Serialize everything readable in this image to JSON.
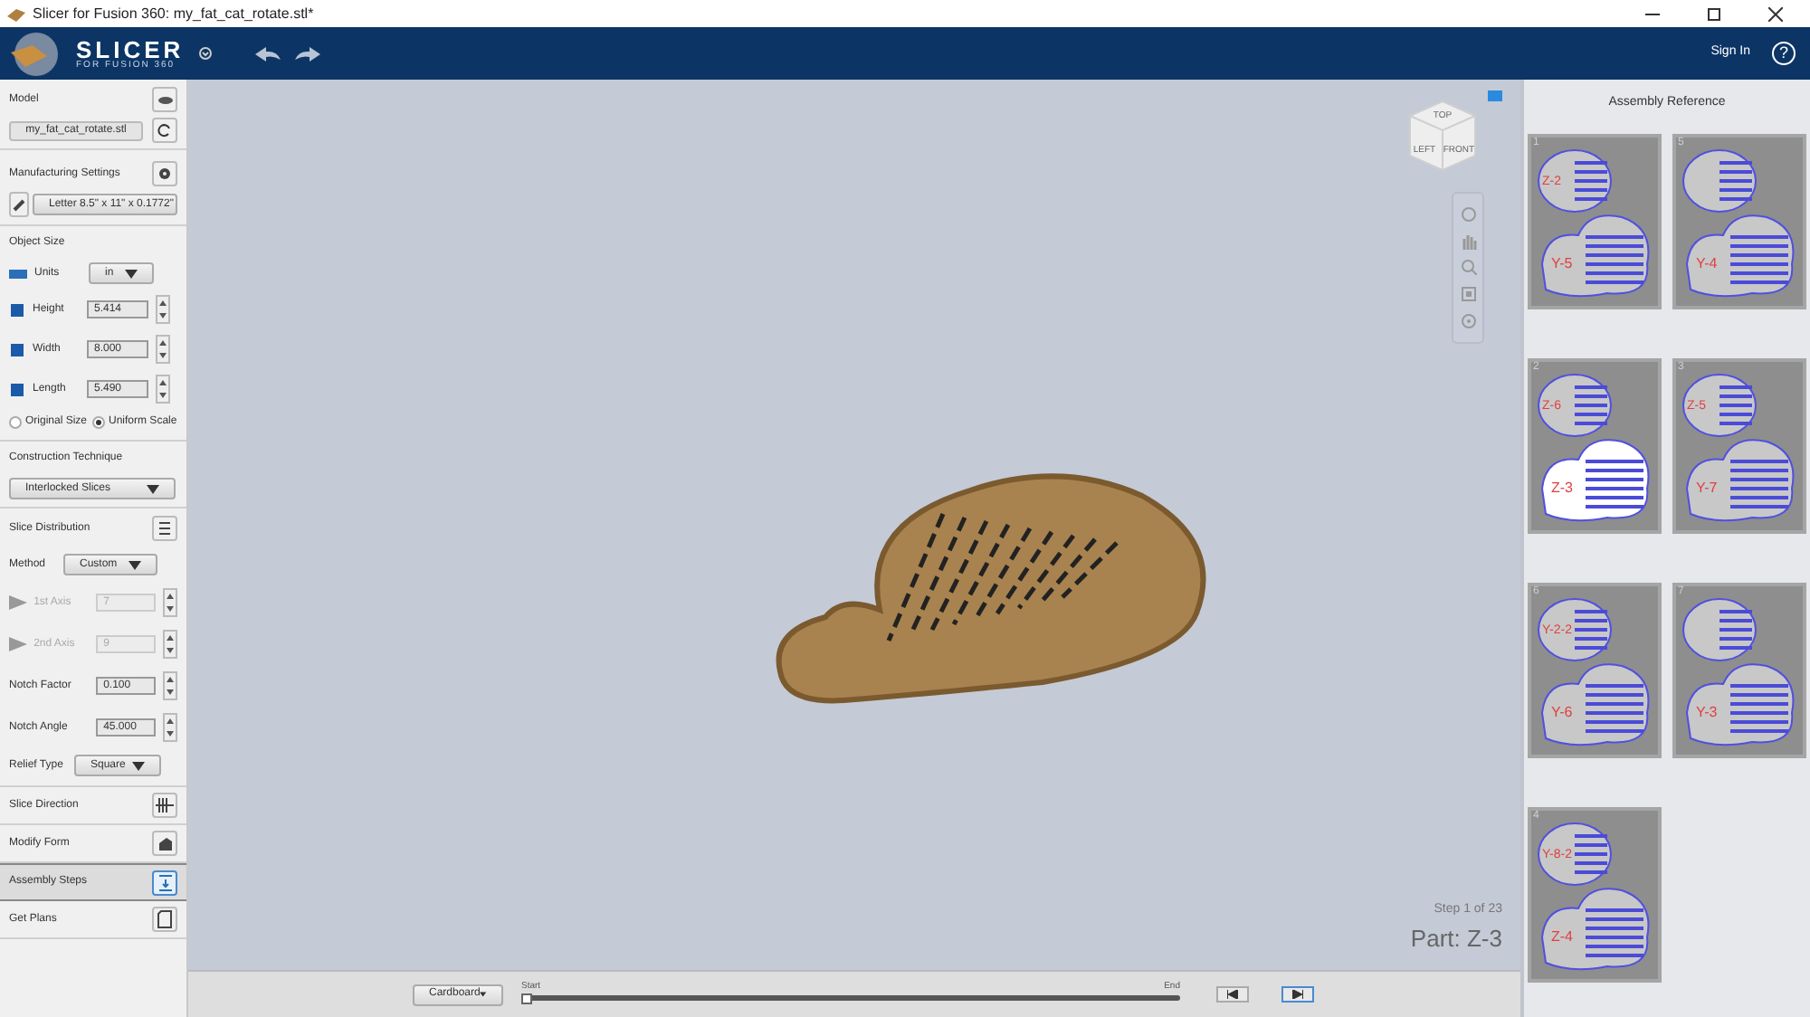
{
  "window": {
    "title": "Slicer for Fusion 360: my_fat_cat_rotate.stl*"
  },
  "header": {
    "logo_title": "SLICER",
    "logo_subtitle": "FOR FUSION 360",
    "sign_in": "Sign In",
    "help": "?"
  },
  "model": {
    "title": "Model",
    "file": "my_fat_cat_rotate.stl"
  },
  "manufacturing": {
    "title": "Manufacturing Settings",
    "sheet": "Letter 8.5\" x 11\" x 0.1772\""
  },
  "object_size": {
    "title": "Object Size",
    "units_label": "Units",
    "units": "in",
    "fields": [
      {
        "label": "Height",
        "value": "5.414"
      },
      {
        "label": "Width",
        "value": "8.000"
      },
      {
        "label": "Length",
        "value": "5.490"
      }
    ],
    "radios": [
      {
        "label": "Original Size",
        "selected": false
      },
      {
        "label": "Uniform Scale",
        "selected": true
      }
    ]
  },
  "construction": {
    "title": "Construction Technique",
    "technique": "Interlocked Slices"
  },
  "slice_distribution": {
    "title": "Slice Distribution",
    "method_label": "Method",
    "method": "Custom",
    "fields": [
      {
        "kind": "axis",
        "label": "1st Axis",
        "value": "7",
        "disabled": true
      },
      {
        "kind": "axis",
        "label": "2nd Axis",
        "value": "9",
        "disabled": true
      },
      {
        "kind": "number",
        "label": "Notch Factor",
        "value": "0.100",
        "disabled": false
      },
      {
        "kind": "number",
        "label": "Notch Angle",
        "value": "45.000",
        "disabled": false
      }
    ],
    "relief_label": "Relief Type",
    "relief": "Square"
  },
  "steps": [
    {
      "kind": "direction",
      "label": "Slice Direction",
      "selected": false
    },
    {
      "kind": "form",
      "label": "Modify Form",
      "selected": false
    },
    {
      "kind": "assembly",
      "label": "Assembly Steps",
      "selected": true
    },
    {
      "kind": "plans",
      "label": "Get Plans",
      "selected": false
    }
  ],
  "viewcube": {
    "top": "TOP",
    "left": "LEFT",
    "front": "FRONT"
  },
  "step_info": {
    "step": "Step 1 of 23",
    "part": "Part: Z-3"
  },
  "bottom_bar": {
    "material": "Cardboard",
    "start": "Start",
    "end": "End",
    "level": 0
  },
  "assembly_reference": {
    "title": "Assembly Reference",
    "sheets": [
      {
        "number": "1",
        "top": "Z-2",
        "bottom": "Y-5",
        "highlighted": false
      },
      {
        "number": "5",
        "bottom": "Y-4",
        "highlighted": false
      },
      {
        "number": "2",
        "top": "Z-6",
        "bottom": "Z-3",
        "highlighted": true
      },
      {
        "number": "3",
        "top": "Z-5",
        "bottom": "Y-7",
        "highlighted": false
      },
      {
        "number": "6",
        "top": "Y-2-2",
        "bottom": "Y-6",
        "highlighted": false
      },
      {
        "number": "7",
        "bottom": "Y-3",
        "highlighted": false
      },
      {
        "number": "4",
        "top": "Y-8-2",
        "bottom": "Z-4",
        "highlighted": false
      }
    ]
  }
}
